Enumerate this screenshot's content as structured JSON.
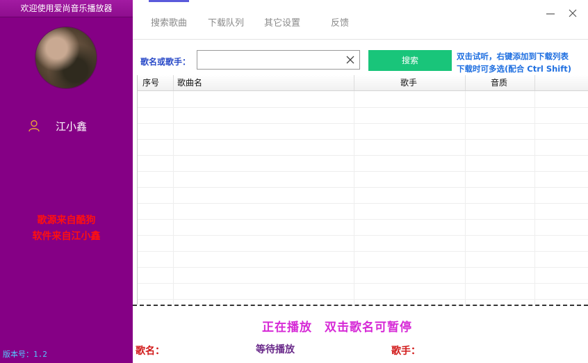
{
  "sidebar": {
    "title": "欢迎使用爱尚音乐播放器",
    "user_name": "江小鑫",
    "credits": [
      "歌源来自酷狗",
      "软件来自江小鑫"
    ],
    "version": "版本号：1.2"
  },
  "nav": {
    "tabs": [
      "搜索歌曲",
      "下载队列",
      "其它设置",
      "反馈"
    ],
    "active_tab": 0
  },
  "search": {
    "label": "歌名或歌手：",
    "value": "",
    "placeholder": "",
    "button_label": "搜索",
    "hint_line1": "双击试听，右键添加到下载列表",
    "hint_line2": "下载时可多选(配合 Ctrl Shift)"
  },
  "table": {
    "columns": [
      "序号",
      "歌曲名",
      "歌手",
      "音质"
    ],
    "rows": []
  },
  "player": {
    "status": "正在播放",
    "tip": "双击歌名可暂停",
    "song_label": "歌名：",
    "song_name": "等待播放",
    "singer_label": "歌手：",
    "singer_name": ""
  },
  "colors": {
    "sidebar_bg": "#850085",
    "accent_green": "#19c57a",
    "label_blue": "#2a4bc8",
    "hint_blue": "#1f6fe0",
    "credit_red": "#ff1010",
    "playing_magenta": "#d629d6"
  },
  "icons": {
    "user": "user-outline-icon",
    "clear": "close-icon",
    "minimize": "minimize-icon",
    "close": "close-icon"
  }
}
